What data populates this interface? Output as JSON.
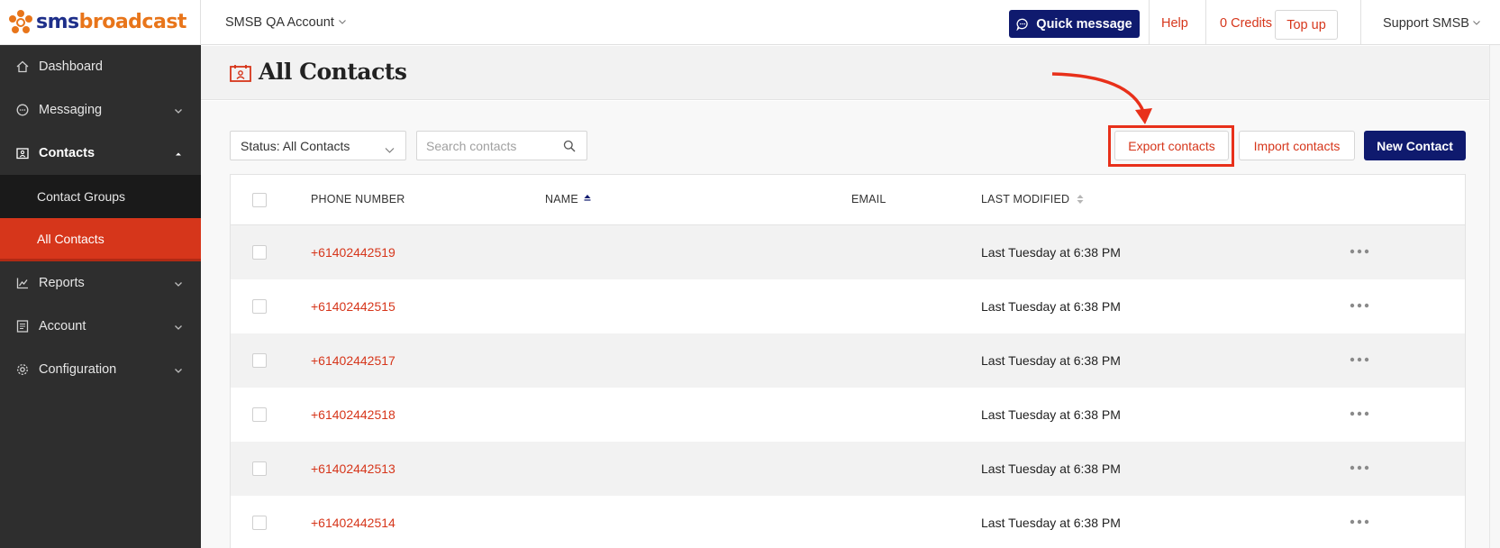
{
  "brand": {
    "logo_sms": "sms",
    "logo_broadcast": "broadcast"
  },
  "colors": {
    "accent": "#d6361b",
    "navy": "#0f1a6e",
    "sidebar": "#2e2e2e"
  },
  "sidebar": {
    "items": [
      {
        "label": "Dashboard",
        "icon": "home-icon"
      },
      {
        "label": "Messaging",
        "icon": "chat-icon"
      },
      {
        "label": "Contacts",
        "icon": "contacts-icon"
      },
      {
        "label": "Reports",
        "icon": "chart-icon"
      },
      {
        "label": "Account",
        "icon": "account-icon"
      },
      {
        "label": "Configuration",
        "icon": "gear-icon"
      }
    ],
    "contacts_sub": [
      {
        "label": "Contact Groups"
      },
      {
        "label": "All Contacts"
      }
    ]
  },
  "topbar": {
    "account": "SMSB QA Account",
    "quick_message": "Quick message",
    "help": "Help",
    "credits": "0 Credits",
    "top_up": "Top up",
    "user": "Support SMSB"
  },
  "page": {
    "title": "All Contacts"
  },
  "toolbar": {
    "status_filter": "Status: All Contacts",
    "search_placeholder": "Search contacts",
    "export": "Export contacts",
    "import": "Import contacts",
    "new_contact": "New Contact"
  },
  "table": {
    "columns": {
      "phone": "PHONE NUMBER",
      "name": "NAME",
      "email": "EMAIL",
      "last_modified": "LAST MODIFIED"
    },
    "rows": [
      {
        "phone": "+61402442519",
        "name": "",
        "email": "",
        "modified": "Last Tuesday at 6:38 PM"
      },
      {
        "phone": "+61402442515",
        "name": "",
        "email": "",
        "modified": "Last Tuesday at 6:38 PM"
      },
      {
        "phone": "+61402442517",
        "name": "",
        "email": "",
        "modified": "Last Tuesday at 6:38 PM"
      },
      {
        "phone": "+61402442518",
        "name": "",
        "email": "",
        "modified": "Last Tuesday at 6:38 PM"
      },
      {
        "phone": "+61402442513",
        "name": "",
        "email": "",
        "modified": "Last Tuesday at 6:38 PM"
      },
      {
        "phone": "+61402442514",
        "name": "",
        "email": "",
        "modified": "Last Tuesday at 6:38 PM"
      }
    ]
  }
}
